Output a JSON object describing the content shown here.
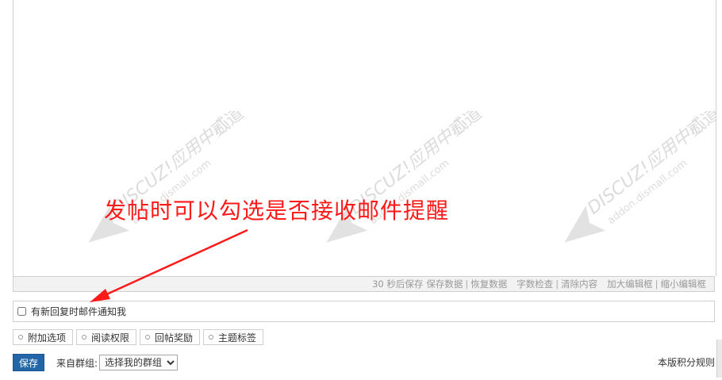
{
  "editor": {
    "watermark": {
      "line1": "DISCUZ!应用中心",
      "line2": "addon.dismall.com",
      "brand": "贰道"
    },
    "status_bar": {
      "autosave": "30 秒后保存",
      "save_data": "保存数据",
      "restore_data": "恢复数据",
      "word_check": "字数检查",
      "clear_content": "清除内容",
      "enlarge_editor": "加大编辑框",
      "shrink_editor": "缩小编辑框"
    }
  },
  "notify": {
    "label": "有新回复时邮件通知我",
    "checked": false
  },
  "options": [
    {
      "label": "附加选项"
    },
    {
      "label": "阅读权限"
    },
    {
      "label": "回帖奖励"
    },
    {
      "label": "主题标签"
    }
  ],
  "bottom": {
    "save_label": "保存",
    "group_label": "来自群组:",
    "group_select_value": "选择我的群组",
    "rules_label": "本版积分规则"
  },
  "annotation": {
    "text": "发帖时可以勾选是否接收邮件提醒",
    "color": "#ff1a1a"
  },
  "colors": {
    "save_button": "#2366a8",
    "border": "#cfcfcf",
    "status_bar_bg": "#f2f2f2"
  }
}
